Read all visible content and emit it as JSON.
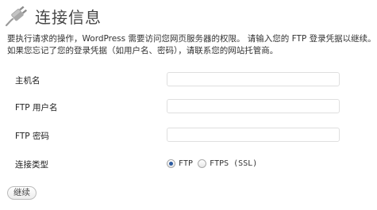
{
  "header": {
    "icon": "plug-icon",
    "title": "连接信息"
  },
  "intro": {
    "line1": "要执行请求的操作，WordPress 需要访问您网页服务器的权限。 请输入您的 FTP 登录凭据以继续。",
    "line2": "如果您忘记了您的登录凭据（如用户名、密码），请联系您的网站托管商。"
  },
  "form": {
    "hostname_label": "主机名",
    "hostname_value": "",
    "username_label": "FTP 用户名",
    "username_value": "",
    "password_label": "FTP 密码",
    "password_value": "",
    "connection_type_label": "连接类型",
    "connection_options": [
      {
        "label": "FTP",
        "selected": true
      },
      {
        "label": "FTPS (SSL)",
        "selected": false
      }
    ]
  },
  "actions": {
    "continue_label": "继续"
  }
}
